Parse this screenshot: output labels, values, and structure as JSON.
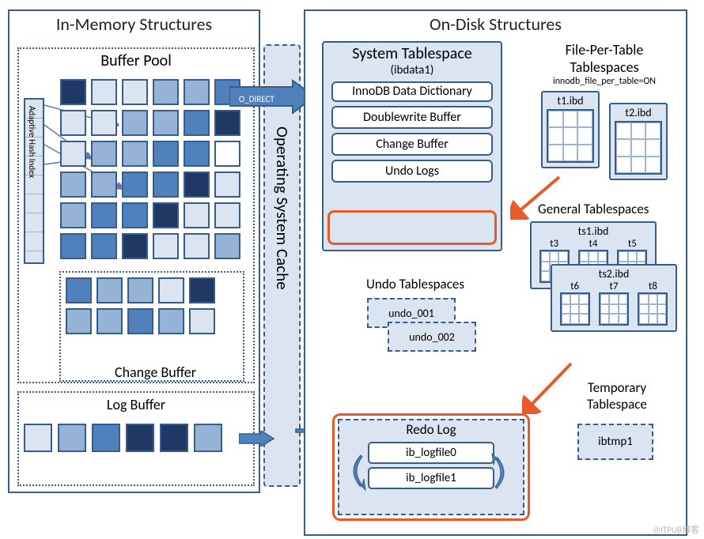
{
  "in_memory": {
    "title": "In-Memory Structures",
    "buffer_pool": {
      "title": "Buffer Pool",
      "ahi_label": "Adaptive Hash Index",
      "change_buffer_label": "Change Buffer"
    },
    "log_buffer": {
      "title": "Log Buffer"
    }
  },
  "os_cache": {
    "label": "Operating System Cache",
    "o_direct": "O_DIRECT"
  },
  "on_disk": {
    "title": "On-Disk Structures",
    "system_tablespace": {
      "title": "System Tablespace",
      "subtitle": "(ibdata1)",
      "items": [
        "InnoDB Data Dictionary",
        "Doublewrite Buffer",
        "Change Buffer",
        "Undo Logs"
      ]
    },
    "file_per_table": {
      "title": "File-Per-Table Tablespaces",
      "subtitle": "innodb_file_per_table=ON",
      "files": [
        "t1.ibd",
        "t2.ibd"
      ]
    },
    "general_tablespaces": {
      "title": "General Tablespaces",
      "files": [
        {
          "name": "ts1.ibd",
          "tables": [
            "t3",
            "t4",
            "t5"
          ]
        },
        {
          "name": "ts2.ibd",
          "tables": [
            "t6",
            "t7",
            "t8"
          ]
        }
      ]
    },
    "undo_tablespaces": {
      "title": "Undo Tablespaces",
      "files": [
        "undo_001",
        "undo_002"
      ]
    },
    "redo_log": {
      "title": "Redo Log",
      "files": [
        "ib_logfile0",
        "ib_logfile1"
      ]
    },
    "temporary_tablespace": {
      "title": "Temporary Tablespace",
      "file": "ibtmp1"
    }
  },
  "watermark": "@ITPUB博客"
}
